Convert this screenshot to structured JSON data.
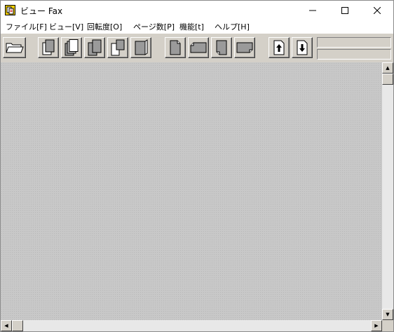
{
  "window": {
    "title": "ビュー Fax"
  },
  "menu": [
    {
      "label": "ファイル[F]"
    },
    {
      "label": "ビュー[V]"
    },
    {
      "label": "回転度[O]"
    },
    {
      "label": "ページ数[P]"
    },
    {
      "label": "機能[t]"
    },
    {
      "label": "ヘルプ[H]"
    }
  ],
  "toolbar": {
    "buttons": [
      {
        "icon": "open-folder-icon"
      },
      {
        "icon": "page-stack-1-icon"
      },
      {
        "icon": "page-stack-2-icon"
      },
      {
        "icon": "page-stack-3-icon"
      },
      {
        "icon": "page-stack-4-icon"
      },
      {
        "icon": "page-stack-5-icon"
      },
      {
        "icon": "page-portrait-icon"
      },
      {
        "icon": "page-landscape-icon"
      },
      {
        "icon": "page-portrait-flip-icon"
      },
      {
        "icon": "page-landscape-flip-icon"
      },
      {
        "icon": "arrow-up-icon"
      },
      {
        "icon": "arrow-down-icon"
      }
    ],
    "status_top": "",
    "status_bottom": ""
  }
}
